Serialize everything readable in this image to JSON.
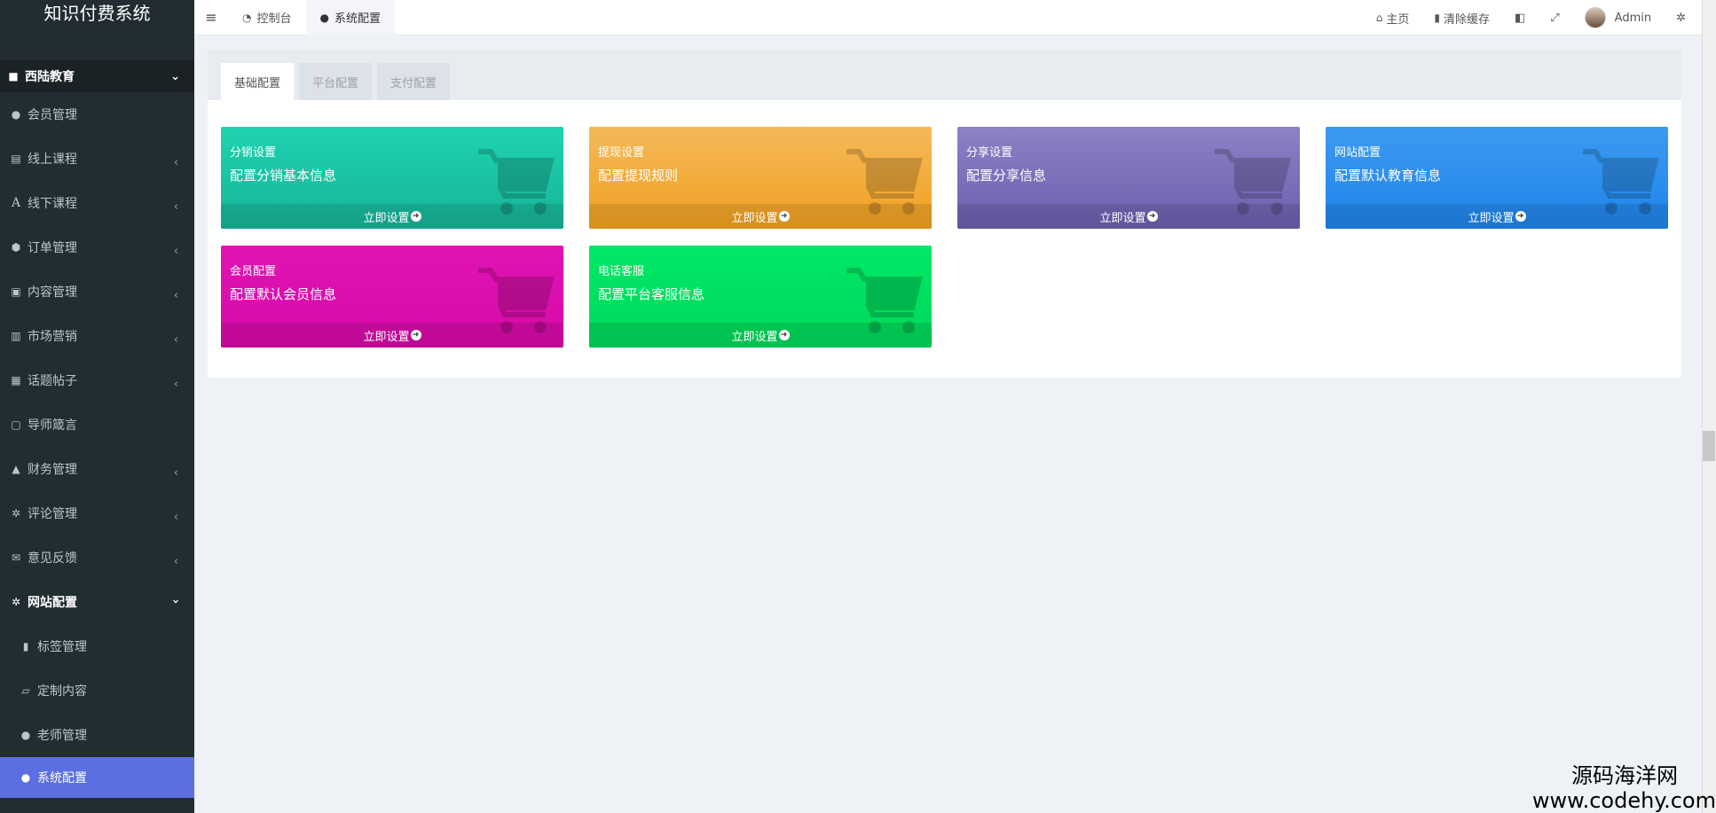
{
  "app": {
    "title": "知识付费系统"
  },
  "sidebar": {
    "group": {
      "label": "西陆教育",
      "icon": "folder-icon"
    },
    "items": [
      {
        "label": "会员管理",
        "icon": "user-icon",
        "arrow": ""
      },
      {
        "label": "线上课程",
        "icon": "book-icon",
        "arrow": "‹"
      },
      {
        "label": "线下课程",
        "icon": "font-icon",
        "arrow": "‹"
      },
      {
        "label": "订单管理",
        "icon": "cube-icon",
        "arrow": "‹"
      },
      {
        "label": "内容管理",
        "icon": "list-icon",
        "arrow": "‹"
      },
      {
        "label": "市场营销",
        "icon": "chart-icon",
        "arrow": "‹"
      },
      {
        "label": "话题帖子",
        "icon": "doc-icon",
        "arrow": "‹"
      },
      {
        "label": "导师箴言",
        "icon": "calendar-icon",
        "arrow": ""
      },
      {
        "label": "财务管理",
        "icon": "bank-icon",
        "arrow": "‹"
      },
      {
        "label": "评论管理",
        "icon": "gear-icon",
        "arrow": "‹"
      },
      {
        "label": "意见反馈",
        "icon": "mail-icon",
        "arrow": "‹"
      },
      {
        "label": "网站配置",
        "icon": "gear-icon",
        "arrow": "‹"
      }
    ],
    "subitems": [
      {
        "label": "标签管理",
        "icon": "bookmark-icon"
      },
      {
        "label": "定制内容",
        "icon": "folder-open-icon"
      },
      {
        "label": "老师管理",
        "icon": "user-plus-icon"
      },
      {
        "label": "系统配置",
        "icon": "user-plus-icon"
      }
    ]
  },
  "header": {
    "tabs": [
      {
        "label": "控制台",
        "icon": "dashboard-icon"
      },
      {
        "label": "系统配置",
        "icon": "user-plus-icon"
      }
    ],
    "right": {
      "home": "主页",
      "clear_cache": "清除缓存",
      "user": "Admin"
    }
  },
  "panel": {
    "tabs": [
      "基础配置",
      "平台配置",
      "支付配置"
    ],
    "cards": [
      {
        "title": "分销设置",
        "desc": "配置分销基本信息",
        "action": "立即设置",
        "color_top": "#1fd3b0",
        "color_bottom": "#17b397"
      },
      {
        "title": "提现设置",
        "desc": "配置提现规则",
        "action": "立即设置",
        "color_top": "#f5b95a",
        "color_bottom": "#f0a020"
      },
      {
        "title": "分享设置",
        "desc": "配置分享信息",
        "action": "立即设置",
        "color_top": "#8c82c5",
        "color_bottom": "#6b5fae"
      },
      {
        "title": "网站配置",
        "desc": "配置默认教育信息",
        "action": "立即设置",
        "color_top": "#3c9af0",
        "color_bottom": "#1f84ea"
      },
      {
        "title": "会员配置",
        "desc": "配置默认会员信息",
        "action": "立即设置",
        "color_top": "#e014b2",
        "color_bottom": "#d60aa8"
      },
      {
        "title": "电话客服",
        "desc": "配置平台客服信息",
        "action": "立即设置",
        "color_top": "#00e866",
        "color_bottom": "#00d85a"
      }
    ]
  },
  "watermark": {
    "line1": "源码海洋网",
    "line2": "www.codehy.com"
  }
}
